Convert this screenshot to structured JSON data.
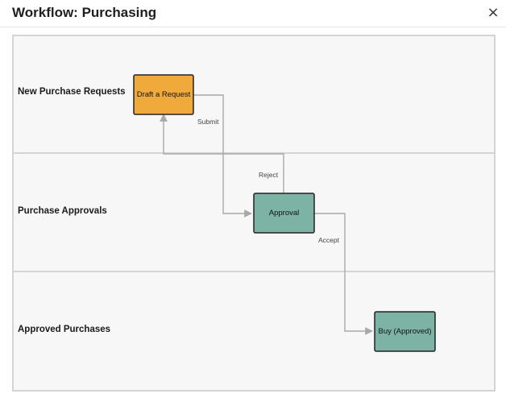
{
  "dialog": {
    "title": "Workflow: Purchasing",
    "close_label": "×"
  },
  "lanes": [
    {
      "label": "New Purchase Requests"
    },
    {
      "label": "Purchase Approvals"
    },
    {
      "label": "Approved Purchases"
    }
  ],
  "nodes": {
    "draft": {
      "label": "Draft a Request",
      "fill": "#f0a93b"
    },
    "approval": {
      "label": "Approval",
      "fill": "#7db3a4"
    },
    "buy": {
      "label": "Buy (Approved)",
      "fill": "#7db3a4"
    }
  },
  "edges": {
    "submit": {
      "label": "Submit"
    },
    "reject": {
      "label": "Reject"
    },
    "accept": {
      "label": "Accept"
    }
  },
  "colors": {
    "lane_fill": "#f7f7f7",
    "lane_border": "#d4d4d4",
    "edge": "#a8a8a8",
    "node_border": "#222222"
  }
}
